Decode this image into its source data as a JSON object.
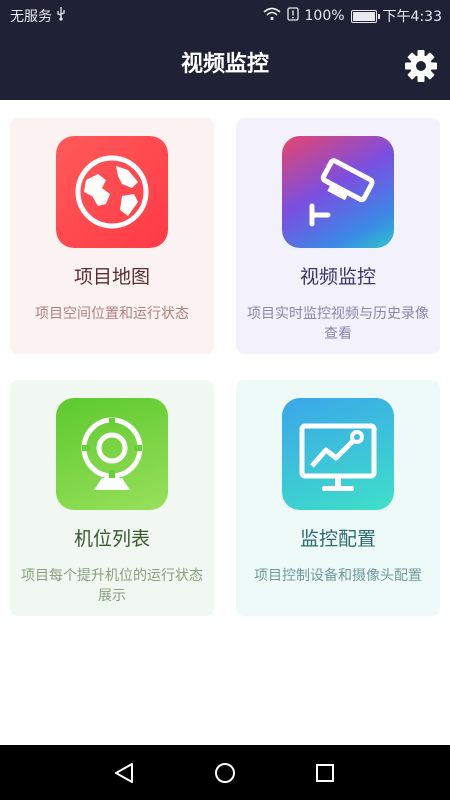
{
  "status_bar": {
    "carrier": "无服务",
    "battery": "100%",
    "time": "下午4:33",
    "battery_level": 1.0
  },
  "header": {
    "title": "视频监控"
  },
  "cards": [
    {
      "name": "项目地图",
      "desc": "项目空间位置和运行状态",
      "icon": "globe-icon",
      "bg": "#fbf2f2",
      "name_color": "#5a2f2f",
      "desc_color": "#b08080",
      "icon_color": "#ff4a4a"
    },
    {
      "name": "视频监控",
      "desc": "项目实时监控视频与历史录像查看",
      "icon": "cctv-camera-icon",
      "bg": "#f3f1fc",
      "name_color": "#3b3563",
      "desc_color": "#8a86a6",
      "icon_color": "#5b5fe0"
    },
    {
      "name": "机位列表",
      "desc": "项目每个提升机位的运行状态展示",
      "icon": "webcam-icon",
      "bg": "#f1f7f1",
      "name_color": "#3a5a34",
      "desc_color": "#86a081",
      "icon_color": "#6cd03a"
    },
    {
      "name": "监控配置",
      "desc": "项目控制设备和摄像头配置",
      "icon": "monitor-chart-icon",
      "bg": "#eefaf8",
      "name_color": "#2a6a70",
      "desc_color": "#6e9a9d",
      "icon_color": "#35b6e0"
    }
  ],
  "nav": {
    "back": "back-icon",
    "home": "home-icon",
    "recent": "recent-apps-icon"
  }
}
